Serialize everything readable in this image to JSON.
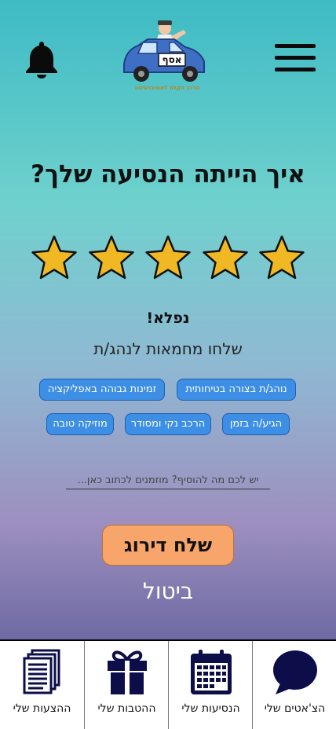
{
  "header": {
    "logo_plate": "אסף",
    "logo_caption": "הדרך הקלה לאוניברסיטה"
  },
  "rating": {
    "question": "איך הייתה הנסיעה שלך?",
    "stars_selected": 5,
    "stars_total": 5,
    "star_color": "#f0b823",
    "rating_word": "נפלא!",
    "compliments_title": "שלחו מחמאות לנהג/ת"
  },
  "tags": [
    "נוהג/ת בצורה בטיחותית",
    "זמינות גבוהה באפליקציה",
    "הגיע/ה בזמן",
    "הרכב נקי ומסודר",
    "מוזיקה טובה"
  ],
  "comment": {
    "placeholder": "יש לכם מה להוסיף? מוזמנים לכתוב כאן...",
    "value": ""
  },
  "actions": {
    "submit_label": "שלח דירוג",
    "cancel_label": "ביטול",
    "submit_color": "#f7a56a"
  },
  "bottom_nav": [
    {
      "label": "הצ'אטים שלי",
      "icon": "chat-icon"
    },
    {
      "label": "הנסיעות שלי",
      "icon": "calendar-icon"
    },
    {
      "label": "ההטבות שלי",
      "icon": "gift-icon"
    },
    {
      "label": "ההצעות שלי",
      "icon": "documents-icon"
    }
  ],
  "colors": {
    "tag_bg": "#3d8fe6",
    "nav_icon": "#0d0d4a"
  }
}
